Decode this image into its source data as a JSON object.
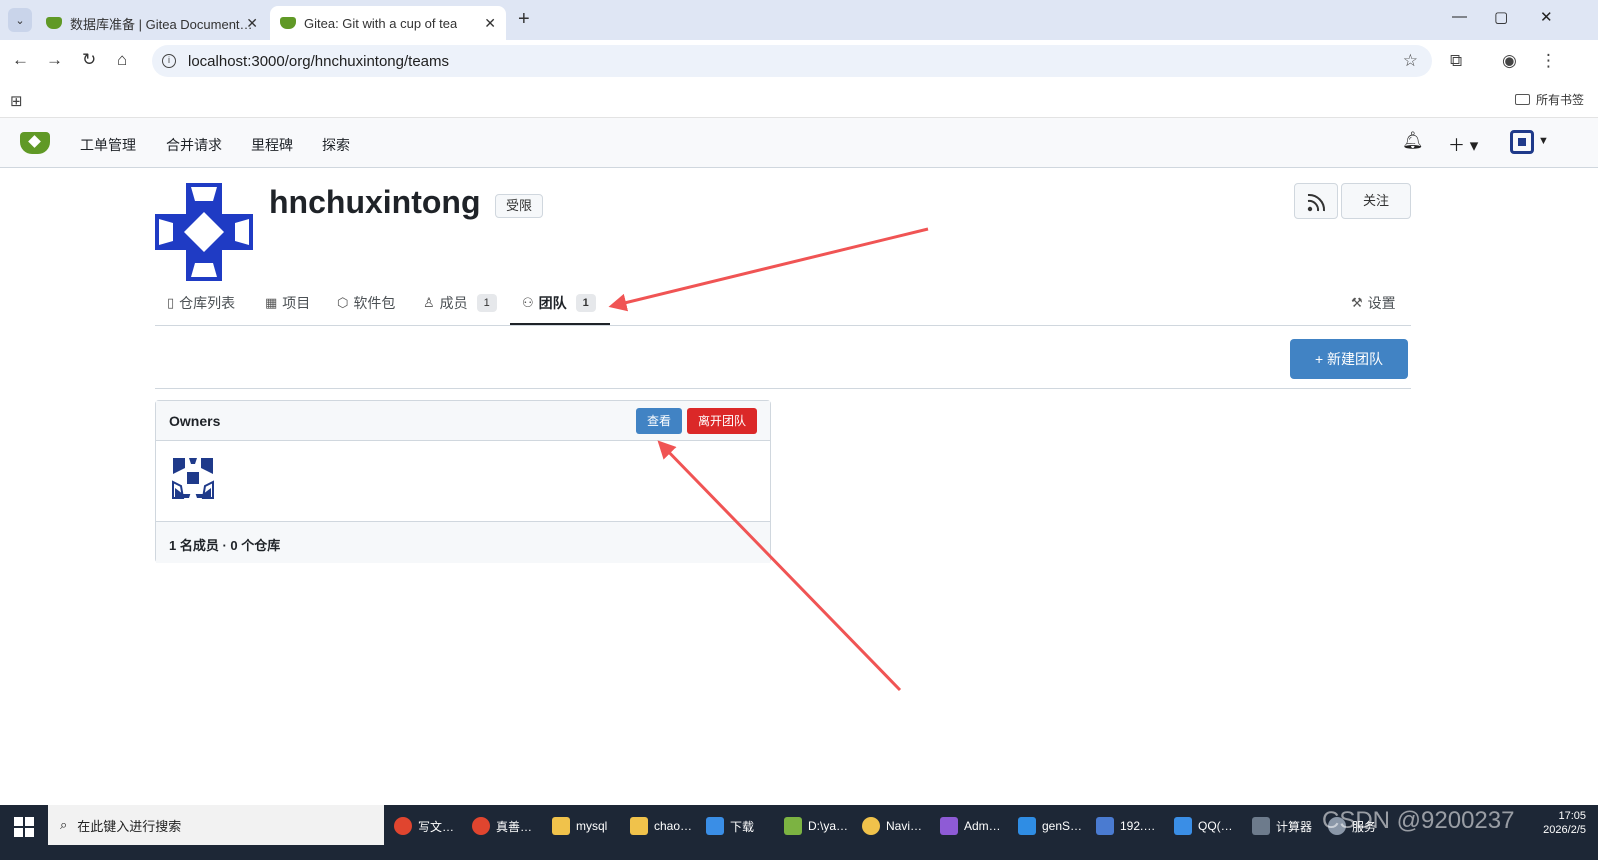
{
  "browser": {
    "tabs": [
      {
        "title": "数据库准备 | Gitea Document…",
        "active": false
      },
      {
        "title": "Gitea: Git with a cup of tea",
        "active": true
      }
    ],
    "url": "localhost:3000/org/hnchuxintong/teams",
    "bookmarks_all": "所有书签",
    "controls": {
      "minimize": "—",
      "maximize": "▢",
      "close": "✕",
      "newtab": "+"
    }
  },
  "gitea_nav": {
    "items": [
      "工单管理",
      "合并请求",
      "里程碑",
      "探索"
    ]
  },
  "org": {
    "name": "hnchuxintong",
    "visibility_badge": "受限",
    "follow_label": "关注"
  },
  "org_tabs": [
    {
      "icon": "repo-icon",
      "label": "仓库列表"
    },
    {
      "icon": "project-icon",
      "label": "项目"
    },
    {
      "icon": "package-icon",
      "label": "软件包"
    },
    {
      "icon": "person-icon",
      "label": "成员",
      "count": "1"
    },
    {
      "icon": "people-icon",
      "label": "团队",
      "count": "1",
      "active": true
    }
  ],
  "settings_label": "设置",
  "new_team_label": "+ 新建团队",
  "team_card": {
    "name": "Owners",
    "view_label": "查看",
    "leave_label": "离开团队",
    "summary": "1 名成员 · 0 个仓库"
  },
  "taskbar": {
    "search_placeholder": "在此键入进行搜索",
    "apps": [
      "写文…",
      "真善…",
      "mysql",
      "chao…",
      "下载",
      "D:\\ya…",
      "Navi…",
      "Adm…",
      "genS…",
      "192.…",
      "QQ(…",
      "计算器",
      "服务"
    ],
    "time": "17:05",
    "date": "2026/2/5",
    "watermark": "CSDN @9200237"
  },
  "colors": {
    "primary": "#4183c4",
    "danger": "#db2828",
    "annotation": "#f05454",
    "gitea_green": "#609926"
  }
}
